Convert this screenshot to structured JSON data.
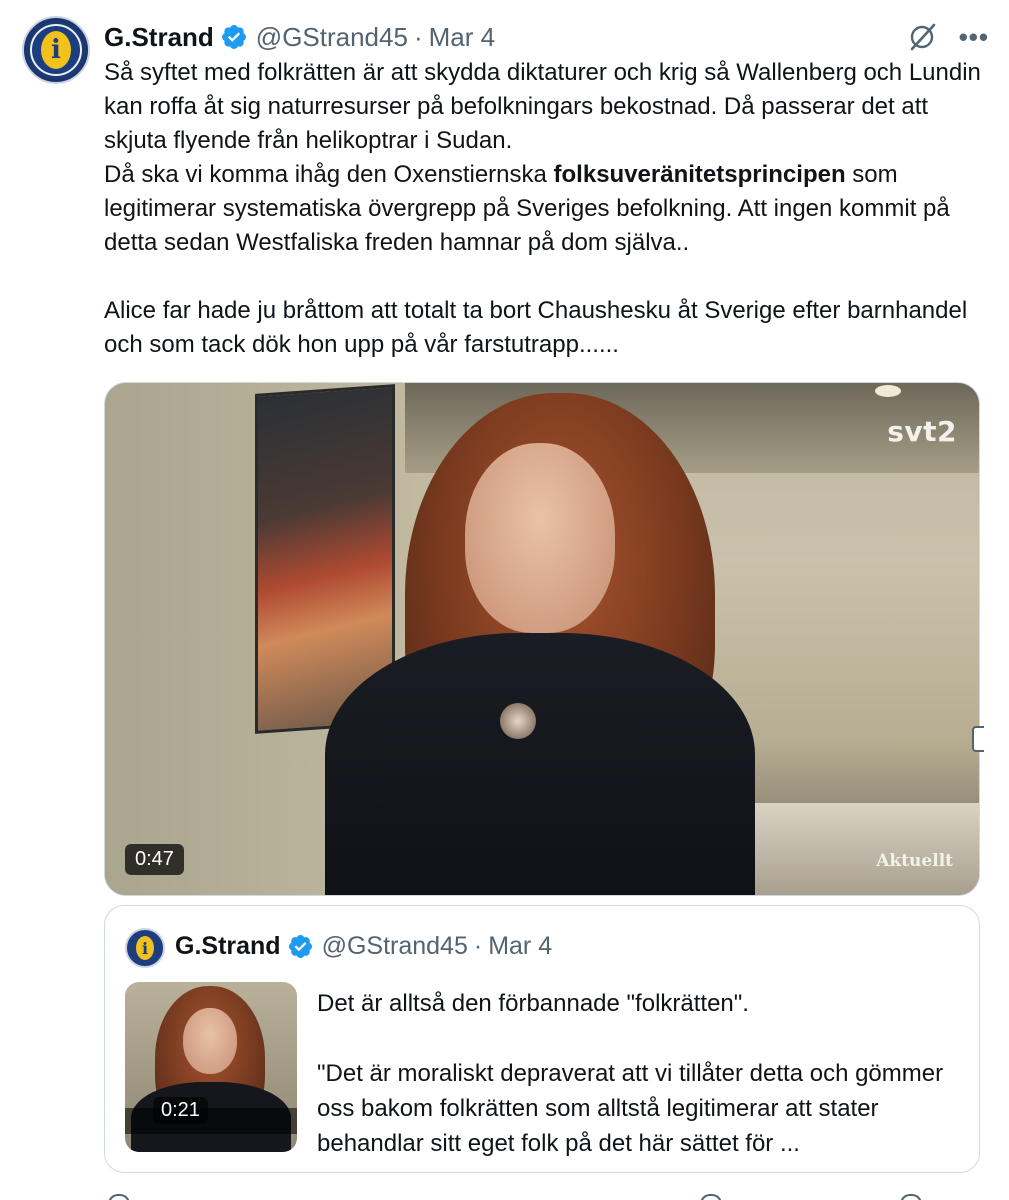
{
  "author": {
    "name": "G.Strand",
    "handle": "@GStrand45",
    "separator": "·",
    "date": "Mar 4",
    "avatar_letter": "i",
    "verified": true
  },
  "tweet": {
    "lines": [
      {
        "text": "Så syftet med folkrätten är att skydda diktaturer och krig så Wallenberg och Lundin kan roffa åt sig naturresurser på befolkningars bekostnad. Då passerar det att skjuta flyende från helikoptrar i Sudan."
      },
      {
        "pre": "Då ska vi komma ihåg den Oxenstiernska ",
        "bold": "folksuveränitetsprincipen",
        "post": " som legitimerar systematiska övergrepp på Sveriges befolkning. Att ingen kommit på detta sedan Westfaliska freden hamnar på dom själva.."
      },
      {
        "text": "Alice far hade ju bråttom att totalt ta bort Chaushesku åt Sverige efter barnhandel och som tack dök hon upp på vår farstutrapp......"
      }
    ]
  },
  "video": {
    "duration": "0:47",
    "channel_logo": "svt2",
    "program_label": "Aktuellt"
  },
  "quote": {
    "name": "G.Strand",
    "handle": "@GStrand45",
    "separator": "·",
    "date": "Mar 4",
    "avatar_letter": "i",
    "thumb_duration": "0:21",
    "paragraph1": "Det är alltså den förbannade \"folkrätten\".",
    "paragraph2": "\"Det är moraliskt depraverat att vi tillåter detta och gömmer oss bakom folkrätten som alltstå legitimerar att stater behandlar sitt eget folk på det här sättet för ..."
  },
  "icons": {
    "verified": "verified-badge-icon",
    "grok": "grok-icon",
    "more": "more-icon",
    "verified_color": "#1d9bf0"
  },
  "more_label": "•••"
}
